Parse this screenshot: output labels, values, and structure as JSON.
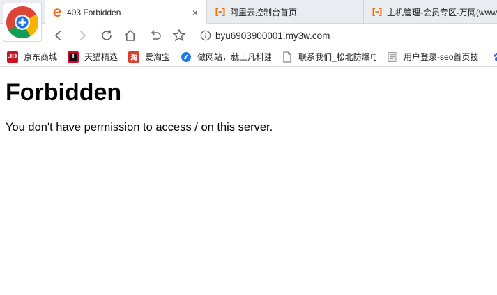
{
  "tabs": [
    {
      "title": "403 Forbidden",
      "active": true,
      "close": "×"
    },
    {
      "title": "阿里云控制台首页",
      "active": false
    },
    {
      "title": "主机管理-会员专区-万网(www",
      "active": false
    }
  ],
  "address_bar": {
    "url": "byu6903900001.my3w.com"
  },
  "bookmarks": [
    {
      "label": "京东商城",
      "icon": "jd-icon",
      "badge": "JD",
      "color": "#c81623"
    },
    {
      "label": "天猫精选",
      "icon": "tmall-icon",
      "badge": "T",
      "color": "#e4002b"
    },
    {
      "label": "爱淘宝",
      "icon": "taobao-icon",
      "badge": "淘",
      "color": "#d6402e"
    },
    {
      "label": "做网站，就上凡科建",
      "icon": "fkw-icon",
      "badge": "",
      "color": "#1e7ee8"
    },
    {
      "label": "联系我们_松北防爆电",
      "icon": "page-icon",
      "badge": "",
      "color": "#888888"
    },
    {
      "label": "用户登录-seo首页技",
      "icon": "doc-icon",
      "badge": "",
      "color": "#9aa0a6"
    },
    {
      "label": "",
      "icon": "baidu-paw-icon",
      "badge": "",
      "color": "#2f6bd8"
    }
  ],
  "page": {
    "heading": "Forbidden",
    "message": "You don't have permission to access / on this server."
  },
  "colors": {
    "chrome_tab_bg": "#e9ecf0",
    "accent_orange": "#f26b1d",
    "aliyun_orange": "#ff6a00"
  }
}
